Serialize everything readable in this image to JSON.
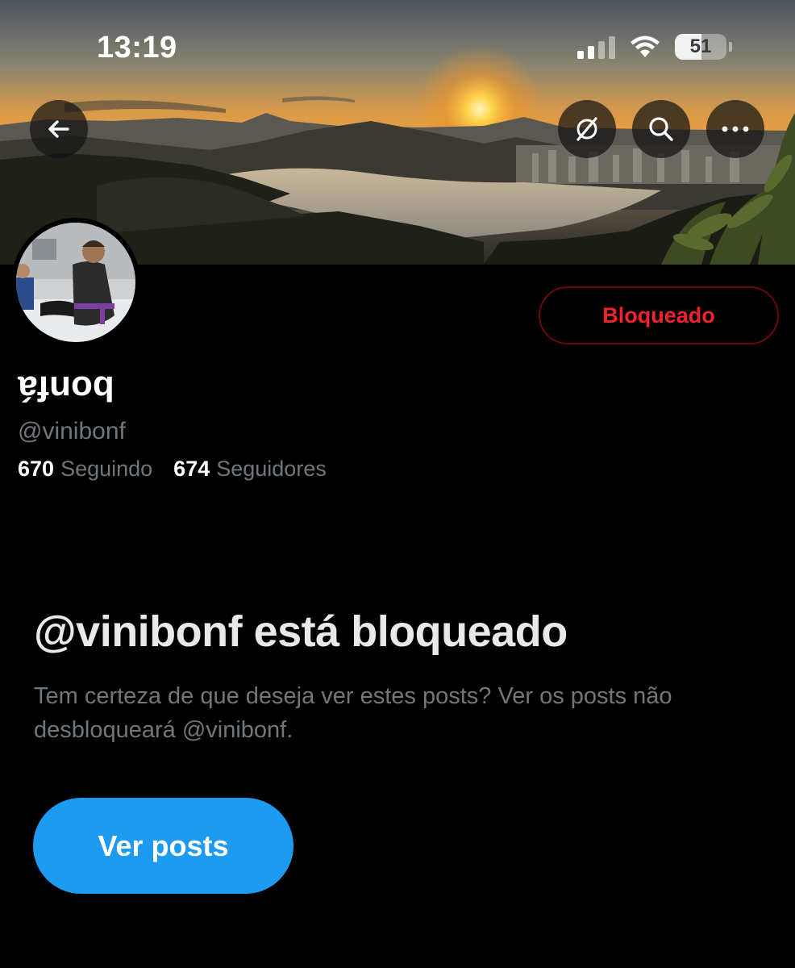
{
  "status_bar": {
    "time": "13:19",
    "battery_level": "51",
    "signal_bars_active": 2,
    "signal_bars_total": 4,
    "icons": [
      "cellular-signal-icon",
      "wifi-icon",
      "battery-icon"
    ]
  },
  "header": {
    "back_icon": "arrow-left-icon",
    "grok_icon": "grok-icon",
    "search_icon": "search-icon",
    "more_icon": "more-horizontal-icon"
  },
  "profile": {
    "display_name": "bonfá",
    "handle": "@vinibonf",
    "following_count": "670",
    "following_label": "Seguindo",
    "followers_count": "674",
    "followers_label": "Seguidores",
    "relationship_button": "Bloqueado"
  },
  "blocked_notice": {
    "title": "@vinibonf está bloqueado",
    "description": "Tem certeza de que deseja ver estes posts? Ver os posts não desbloqueará @vinibonf.",
    "view_posts_button": "Ver posts"
  },
  "colors": {
    "background": "#000000",
    "accent_blue": "#1d9bf0",
    "blocked_red": "#f4212e",
    "secondary_text": "#71767b"
  }
}
